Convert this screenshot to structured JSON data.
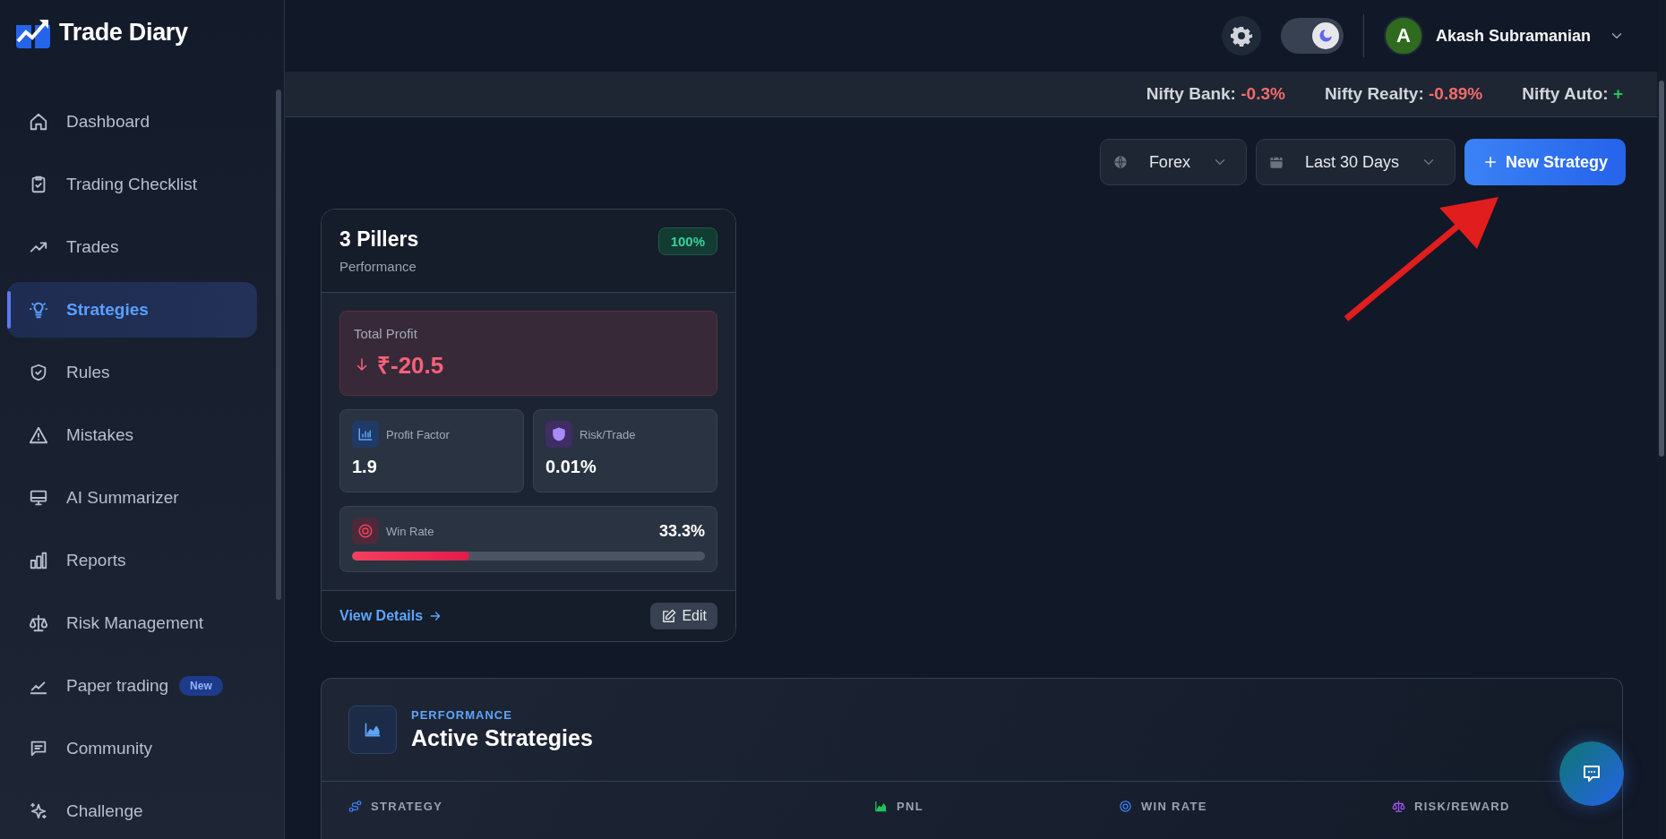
{
  "brand": {
    "name": "Trade Diary"
  },
  "sidebar": {
    "items": [
      {
        "label": "Dashboard",
        "selected": false
      },
      {
        "label": "Trading Checklist",
        "selected": false
      },
      {
        "label": "Trades",
        "selected": false
      },
      {
        "label": "Strategies",
        "selected": true
      },
      {
        "label": "Rules",
        "selected": false
      },
      {
        "label": "Mistakes",
        "selected": false
      },
      {
        "label": "AI Summarizer",
        "selected": false
      },
      {
        "label": "Reports",
        "selected": false
      },
      {
        "label": "Risk Management",
        "selected": false
      },
      {
        "label": "Paper trading",
        "selected": false,
        "badge": "New"
      },
      {
        "label": "Community",
        "selected": false
      },
      {
        "label": "Challenge",
        "selected": false
      }
    ]
  },
  "topbar": {
    "theme_toggle": {
      "on": true
    },
    "user": {
      "initial": "A",
      "name": "Akash Subramanian"
    }
  },
  "ticker": [
    {
      "name": "Nifty Bank:",
      "change": "-0.3%",
      "negative": true
    },
    {
      "name": "Nifty Realty:",
      "change": "-0.89%",
      "negative": true
    },
    {
      "name": "Nifty Auto:",
      "change": "+",
      "negative": false
    }
  ],
  "filters": {
    "market": "Forex",
    "period": "Last 30 Days",
    "new_button": "New Strategy"
  },
  "strategy_card": {
    "title": "3 Pillers",
    "subtitle": "Performance",
    "badge": "100%",
    "total_profit": {
      "label": "Total Profit",
      "value": "₹-20.5",
      "negative": true
    },
    "metrics": [
      {
        "kind": "profit_factor",
        "label": "Profit Factor",
        "value": "1.9"
      },
      {
        "kind": "risk",
        "label": "Risk/Trade",
        "value": "0.01%"
      }
    ],
    "win_rate": {
      "label": "Win Rate",
      "value": "33.3%",
      "level": 0.333
    },
    "view_details": "View Details",
    "edit": "Edit"
  },
  "active_strategies": {
    "eyebrow": "PERFORMANCE",
    "title": "Active Strategies",
    "columns": [
      "STRATEGY",
      "PNL",
      "WIN RATE",
      "RISK/REWARD"
    ]
  }
}
